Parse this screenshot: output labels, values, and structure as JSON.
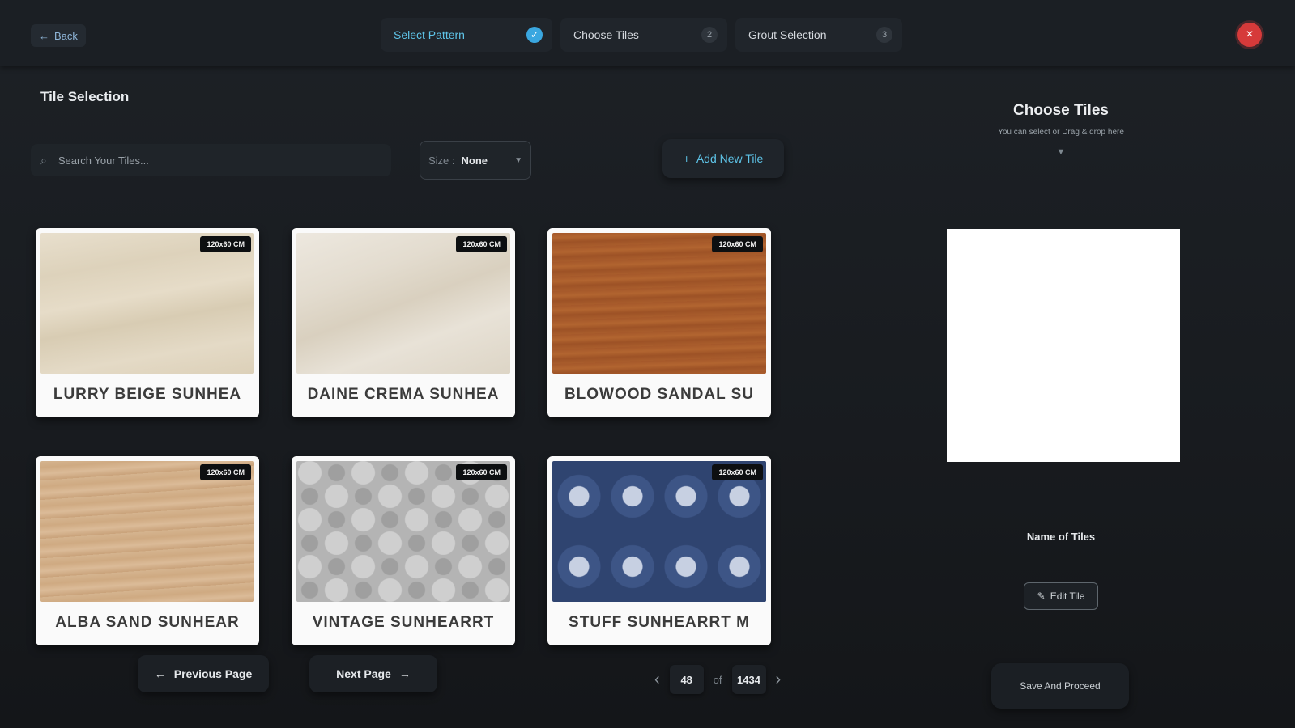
{
  "topbar": {
    "back_label": "Back",
    "steps": [
      {
        "label": "Select Pattern",
        "badge": "✓"
      },
      {
        "label": "Choose Tiles",
        "badge": "2"
      },
      {
        "label": "Grout Selection",
        "badge": "3"
      }
    ],
    "close_symbol": "×"
  },
  "main": {
    "title": "Tile Selection",
    "search_placeholder": "Search Your Tiles...",
    "size_filter": {
      "label": "Size :",
      "value": "None"
    },
    "add_tile_label": "Add New Tile",
    "tiles": [
      {
        "name": "LURRY BEIGE SUNHEA",
        "size": "120x60 CM",
        "texture": "beige"
      },
      {
        "name": "DAINE CREMA SUNHEA",
        "size": "120x60 CM",
        "texture": "crema"
      },
      {
        "name": "BLOWOOD SANDAL SU",
        "size": "120x60 CM",
        "texture": "wood"
      },
      {
        "name": "ALBA SAND SUNHEAR",
        "size": "120x60 CM",
        "texture": "sand"
      },
      {
        "name": "VINTAGE SUNHEARRT",
        "size": "120x60 CM",
        "texture": "vintage"
      },
      {
        "name": "STUFF SUNHEARRT M",
        "size": "120x60 CM",
        "texture": "stuff"
      }
    ],
    "pagination": {
      "prev_label": "Previous Page",
      "next_label": "Next Page",
      "current_page": "48",
      "of_label": "of",
      "total_pages": "1434"
    }
  },
  "right_panel": {
    "title": "Choose Tiles",
    "subtitle": "You can select or Drag & drop here",
    "tile_name_label": "Name of Tiles",
    "edit_label": "Edit Tile",
    "save_label": "Save And Proceed"
  },
  "colors": {
    "accent": "#5ec4e8",
    "close": "#d63a3a",
    "background": "#1a1d21"
  }
}
